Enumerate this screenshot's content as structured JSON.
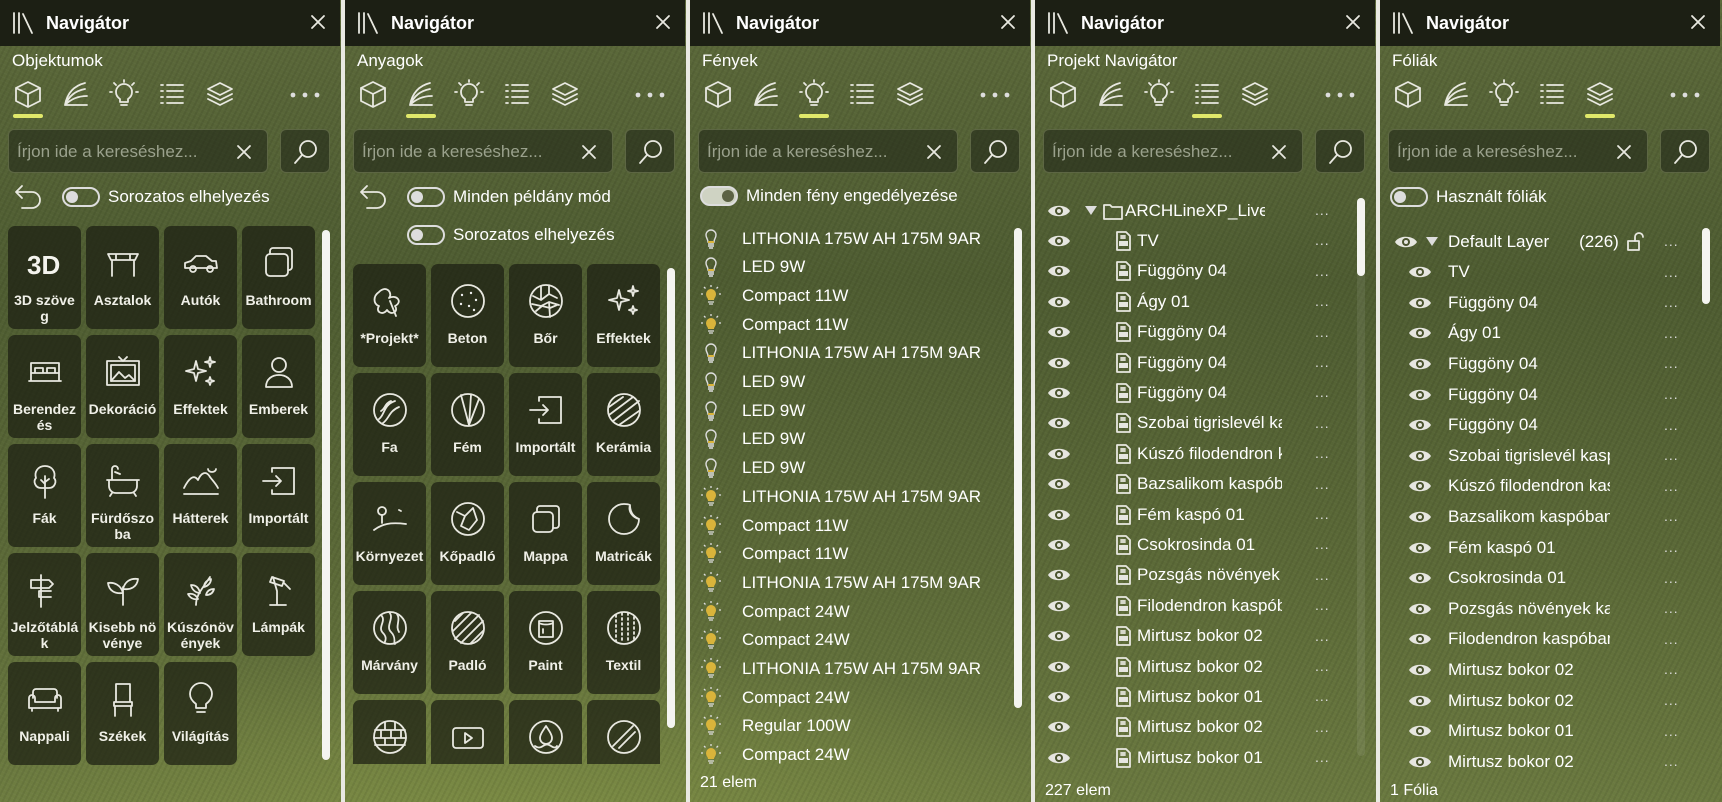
{
  "app": {
    "header_title": "Navigátor",
    "search_placeholder": "Írjon ide a kereséshez..."
  },
  "colors": {
    "accent": "#e0e86a",
    "panel_header": "#1c1f14"
  },
  "panels": [
    {
      "title": "Objektumok",
      "active_tab": "objects",
      "toggles": [
        {
          "label": "Sorozatos elhelyezés",
          "on": false
        }
      ],
      "tiles": [
        {
          "label": "3D szöveg",
          "icon": "3d-text-icon"
        },
        {
          "label": "Asztalok",
          "icon": "table-icon"
        },
        {
          "label": "Autók",
          "icon": "car-icon"
        },
        {
          "label": "Bathroom",
          "icon": "bathroom-icon"
        },
        {
          "label": "Berendezés",
          "icon": "bed-icon"
        },
        {
          "label": "Dekoráció",
          "icon": "picture-icon"
        },
        {
          "label": "Effektek",
          "icon": "sparkle-icon"
        },
        {
          "label": "Emberek",
          "icon": "person-icon"
        },
        {
          "label": "Fák",
          "icon": "tree-icon"
        },
        {
          "label": "Fürdőszoba",
          "icon": "bathtub-icon"
        },
        {
          "label": "Hátterek",
          "icon": "landscape-icon"
        },
        {
          "label": "Importált",
          "icon": "import-icon"
        },
        {
          "label": "Jelzőtáblák",
          "icon": "signpost-icon"
        },
        {
          "label": "Kisebb növénye",
          "icon": "plant-icon"
        },
        {
          "label": "Kúszónövények",
          "icon": "vine-icon"
        },
        {
          "label": "Lámpák",
          "icon": "desk-lamp-icon"
        },
        {
          "label": "Nappali",
          "icon": "sofa-icon"
        },
        {
          "label": "Székek",
          "icon": "chair-icon"
        },
        {
          "label": "Világítás",
          "icon": "lightbulb-icon"
        }
      ]
    },
    {
      "title": "Anyagok",
      "active_tab": "materials",
      "toggles": [
        {
          "label": "Minden példány mód",
          "on": false
        },
        {
          "label": "Sorozatos elhelyezés",
          "on": false
        }
      ],
      "tiles": [
        {
          "label": "*Projekt*",
          "icon": "project-material-icon"
        },
        {
          "label": "Beton",
          "icon": "concrete-icon"
        },
        {
          "label": "Bőr",
          "icon": "leather-icon"
        },
        {
          "label": "Effektek",
          "icon": "sparkle-icon"
        },
        {
          "label": "Fa",
          "icon": "wood-icon"
        },
        {
          "label": "Fém",
          "icon": "metal-icon"
        },
        {
          "label": "Importált",
          "icon": "import-icon"
        },
        {
          "label": "Kerámia",
          "icon": "ceramic-icon"
        },
        {
          "label": "Környezet",
          "icon": "environment-icon"
        },
        {
          "label": "Kőpadló",
          "icon": "stone-floor-icon"
        },
        {
          "label": "Mappa",
          "icon": "folder-icon"
        },
        {
          "label": "Matricák",
          "icon": "decal-icon"
        },
        {
          "label": "Márvány",
          "icon": "marble-icon"
        },
        {
          "label": "Padló",
          "icon": "floor-icon"
        },
        {
          "label": "Paint",
          "icon": "paint-can-icon"
        },
        {
          "label": "Textil",
          "icon": "textile-icon"
        },
        {
          "label": "",
          "icon": "brick-icon"
        },
        {
          "label": "",
          "icon": "video-icon"
        },
        {
          "label": "",
          "icon": "water-icon"
        },
        {
          "label": "",
          "icon": "glass-icon"
        }
      ]
    },
    {
      "title": "Fények",
      "active_tab": "lights",
      "toggle": {
        "label": "Minden fény engedélyezése",
        "on": true
      },
      "lights": [
        {
          "name": "LITHONIA 175W AH 175M 9AR",
          "kind": "off"
        },
        {
          "name": "LED 9W",
          "kind": "off"
        },
        {
          "name": "Compact 11W",
          "kind": "on"
        },
        {
          "name": "Compact 11W",
          "kind": "on"
        },
        {
          "name": "LITHONIA 175W AH 175M 9AR",
          "kind": "off"
        },
        {
          "name": "LED 9W",
          "kind": "off"
        },
        {
          "name": "LED 9W",
          "kind": "off"
        },
        {
          "name": "LED 9W",
          "kind": "off"
        },
        {
          "name": "LED 9W",
          "kind": "off"
        },
        {
          "name": "LITHONIA 175W AH 175M 9AR",
          "kind": "on"
        },
        {
          "name": "Compact 11W",
          "kind": "on"
        },
        {
          "name": "Compact 11W",
          "kind": "on"
        },
        {
          "name": "LITHONIA 175W AH 175M 9AR",
          "kind": "on"
        },
        {
          "name": "Compact 24W",
          "kind": "on"
        },
        {
          "name": "Compact 24W",
          "kind": "on"
        },
        {
          "name": "LITHONIA 175W AH 175M 9AR",
          "kind": "on"
        },
        {
          "name": "Compact 24W",
          "kind": "on"
        },
        {
          "name": "Regular 100W",
          "kind": "on"
        },
        {
          "name": "Compact 24W",
          "kind": "on"
        }
      ],
      "footer": "21  elem"
    },
    {
      "title": "Projekt Navigátor",
      "active_tab": "project",
      "root": "ARCHLineXP_Live",
      "items": [
        "TV",
        "Függöny 04",
        "Ágy 01",
        "Függöny 04",
        "Függöny 04",
        "Függöny 04",
        "Szobai tigrislevél kaspóban",
        "Kúszó filodendron kaspóban",
        "Bazsalikom kaspóban",
        "Fém kaspó 01",
        "Csokrosinda 01",
        "Pozsgás növények kaspóban",
        "Filodendron kaspóban",
        "Mirtusz bokor 02",
        "Mirtusz bokor 02",
        "Mirtusz bokor 01",
        "Mirtusz bokor 02",
        "Mirtusz bokor 01"
      ],
      "footer": "227 elem"
    },
    {
      "title": "Fóliák",
      "active_tab": "layers",
      "toggle": {
        "label": "Használt fóliák",
        "on": false
      },
      "layer": {
        "name": "Default Layer",
        "count": "(226)"
      },
      "items": [
        "TV",
        "Függöny 04",
        "Ágy 01",
        "Függöny 04",
        "Függöny 04",
        "Függöny 04",
        "Szobai tigrislevél kaspóban",
        "Kúszó filodendron kaspóban",
        "Bazsalikom kaspóban",
        "Fém kaspó 01",
        "Csokrosinda 01",
        "Pozsgás növények kaspóban",
        "Filodendron kaspóban",
        "Mirtusz bokor 02",
        "Mirtusz bokor 02",
        "Mirtusz bokor 01",
        "Mirtusz bokor 02"
      ],
      "footer": "1 Fólia"
    }
  ],
  "ellipsis": "...",
  "tab_names": [
    "objects-tab",
    "materials-tab",
    "lights-tab",
    "project-tab",
    "layers-tab"
  ]
}
